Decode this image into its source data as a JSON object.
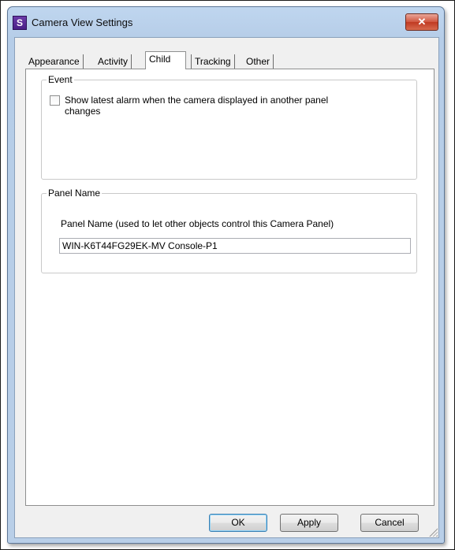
{
  "window": {
    "title": "Camera View Settings",
    "app_icon_letter": "S",
    "close_glyph": "✕"
  },
  "tabs": [
    {
      "label": "Appearance"
    },
    {
      "label": "Activity"
    },
    {
      "label": "Child",
      "active": true
    },
    {
      "label": "Tracking"
    },
    {
      "label": "Other"
    }
  ],
  "event_group": {
    "legend": "Event",
    "checkbox_label": "Show latest alarm when the camera displayed in another panel changes",
    "checkbox_checked": false
  },
  "panel_name_group": {
    "legend": "Panel Name",
    "field_label": "Panel Name (used to let other objects control this Camera Panel)",
    "field_value": "WIN-K6T44FG29EK-MV Console-P1"
  },
  "buttons": {
    "ok": "OK",
    "apply": "Apply",
    "cancel": "Cancel"
  },
  "icons": [
    "app-icon",
    "close-icon",
    "checkbox-icon",
    "resize-grip-icon"
  ]
}
